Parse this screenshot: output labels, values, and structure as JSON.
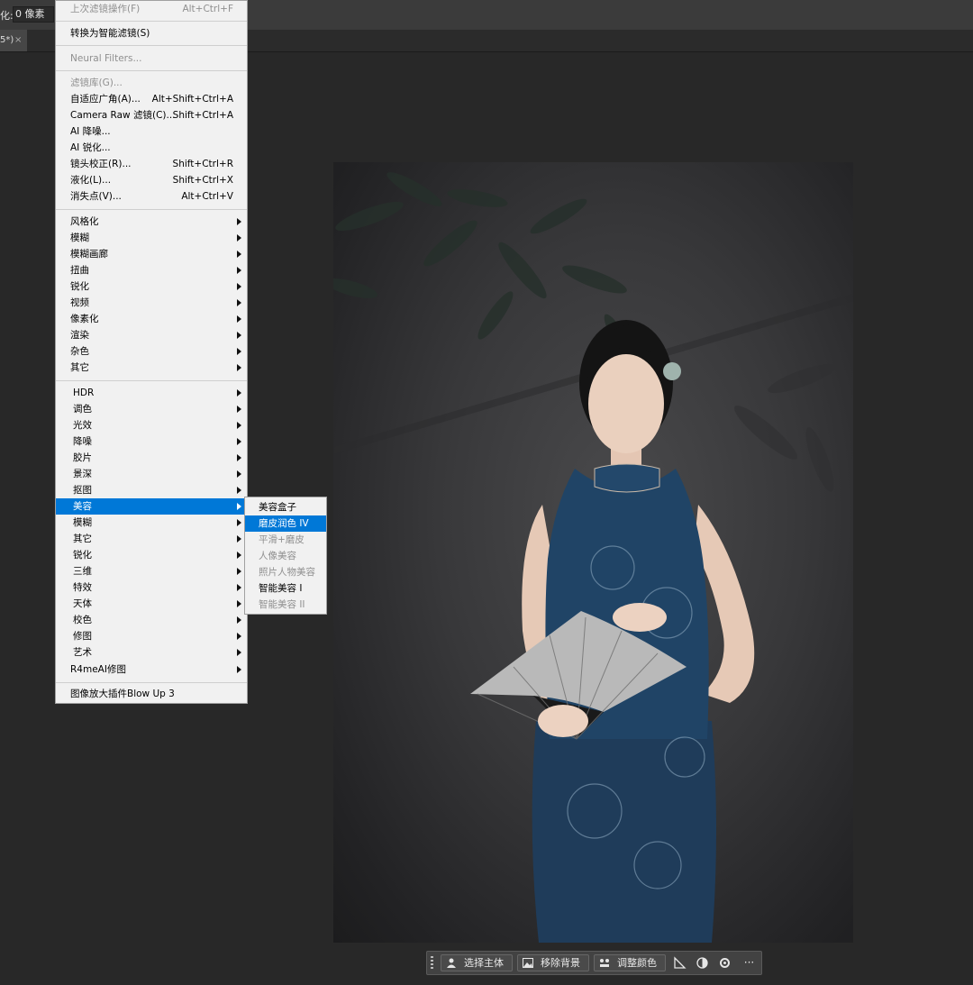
{
  "options_bar": {
    "label": "化:",
    "feather_value": "0 像素"
  },
  "document_tab": {
    "label": "5*)",
    "close": "×"
  },
  "filter_menu": {
    "last_filter": {
      "label": "上次滤镜操作(F)",
      "shortcut": "Alt+Ctrl+F"
    },
    "convert_smart": {
      "label": "转换为智能滤镜(S)"
    },
    "neural_filters": {
      "label": "Neural Filters..."
    },
    "filter_gallery": {
      "label": "滤镜库(G)..."
    },
    "adaptive_wide_angle": {
      "label": "自适应广角(A)...",
      "shortcut": "Alt+Shift+Ctrl+A"
    },
    "camera_raw": {
      "label": "Camera Raw 滤镜(C)...",
      "shortcut": "Shift+Ctrl+A"
    },
    "ai_denoise": {
      "label": "AI 降噪..."
    },
    "ai_sharpen": {
      "label": "AI 锐化..."
    },
    "lens_correction": {
      "label": "镜头校正(R)...",
      "shortcut": "Shift+Ctrl+R"
    },
    "liquify": {
      "label": "液化(L)...",
      "shortcut": "Shift+Ctrl+X"
    },
    "vanishing_point": {
      "label": "消失点(V)...",
      "shortcut": "Alt+Ctrl+V"
    },
    "builtin_groups": [
      "风格化",
      "模糊",
      "模糊画廊",
      "扭曲",
      "锐化",
      "视频",
      "像素化",
      "渲染",
      "杂色",
      "其它"
    ],
    "plugin_groups": [
      "HDR",
      "调色",
      "光效",
      "降噪",
      "胶片",
      "景深",
      "抠图",
      "美容",
      "模糊",
      "其它",
      "锐化",
      "三维",
      "特效",
      "天体",
      "校色",
      "修图",
      "艺术",
      "R4meAI修图"
    ],
    "blow_up": {
      "label": "图像放大插件Blow Up 3"
    }
  },
  "beauty_submenu": {
    "items": [
      "美容盒子",
      "磨皮润色 IV",
      "平滑+磨皮",
      "人像美容",
      "照片人物美容",
      "智能美容 I",
      "智能美容 II"
    ]
  },
  "taskbar": {
    "select_subject": "选择主体",
    "remove_background": "移除背景",
    "adjust_color": "调整颜色",
    "more": "···"
  },
  "colors": {
    "menu_highlight": "#0078d7",
    "menu_background": "#f1f1f1",
    "workspace": "#282828"
  }
}
